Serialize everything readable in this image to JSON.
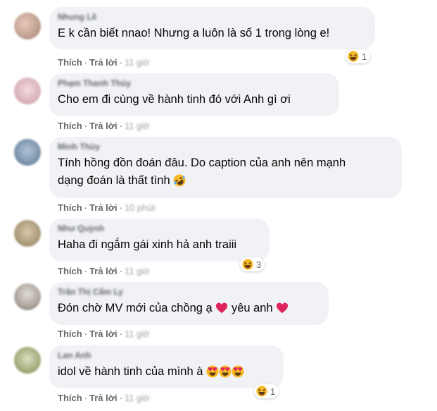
{
  "actions": {
    "like_label": "Thích",
    "reply_label": "Trả lời",
    "separator": "·"
  },
  "comments": [
    {
      "name": "Nhung Lê",
      "text": "E k cần biết nnao! Nhưng a luôn là số 1 trong lòng e!",
      "time": "11 giờ",
      "reaction_count": "1",
      "reaction_icon": "haha-icon"
    },
    {
      "name": "Phạm Thanh Thùy",
      "text": "Cho em đi cùng về hành tinh đó với Anh gì ơi",
      "time": "11 giờ"
    },
    {
      "name": "Minh Thùy",
      "text_line1": "Tính hồng đồn đoán đâu. Do caption của anh nên mạnh",
      "text_line2": "dạng đoán là thất tình",
      "time": "10 phút",
      "emoji": "rofl-emoji"
    },
    {
      "name": "Như Quỳnh",
      "text": "Haha đi ngắm gái xinh hả anh traiii",
      "time": "11 giờ",
      "reaction_count": "3",
      "reaction_icon": "haha-icon"
    },
    {
      "name": "Trần Thị Cẩm Ly",
      "text_part1": "Đón chờ MV mới của chồng ạ",
      "text_part2": "yêu anh",
      "time": "11 giờ",
      "emoji": "red-heart-emoji"
    },
    {
      "name": "Lan Anh",
      "text": "idol về hành tinh của mình à",
      "time": "11 giờ",
      "reaction_count": "1",
      "reaction_icon": "haha-icon",
      "emoji": "heart-eyes-emoji"
    }
  ],
  "colors": {
    "bubble": "#f0f2f5",
    "secondary_text": "#65676b",
    "primary_text": "#050505",
    "reaction_yellow": "#f7b928",
    "heart_red": "#e0245e"
  }
}
